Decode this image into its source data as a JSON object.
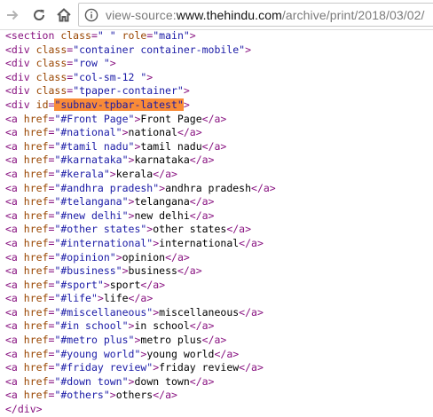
{
  "address_bar": {
    "scheme": "view-source:",
    "host": "www.thehindu.com",
    "path": "/archive/print/2018/03/02/"
  },
  "header_lines": [
    {
      "tag": "section",
      "attrs": [
        {
          "n": "class",
          "v": "\" \""
        },
        {
          "n": "role",
          "v": "\"main\""
        }
      ]
    },
    {
      "tag": "div",
      "attrs": [
        {
          "n": "class",
          "v": "\"container container-mobile\""
        }
      ]
    },
    {
      "tag": "div",
      "attrs": [
        {
          "n": "class",
          "v": "\"row \""
        }
      ]
    },
    {
      "tag": "div",
      "attrs": [
        {
          "n": "class",
          "v": "\"col-sm-12 \""
        }
      ]
    },
    {
      "tag": "div",
      "attrs": [
        {
          "n": "class",
          "v": "\"tpaper-container\""
        }
      ]
    }
  ],
  "subnav_div": {
    "attr": "id",
    "value": "\"subnav-tpbar-latest\""
  },
  "links": [
    {
      "href": "\"#Front Page\"",
      "text": "Front Page"
    },
    {
      "href": "\"#national\"",
      "text": "national"
    },
    {
      "href": "\"#tamil nadu\"",
      "text": "tamil nadu"
    },
    {
      "href": "\"#karnataka\"",
      "text": "karnataka"
    },
    {
      "href": "\"#kerala\"",
      "text": "kerala"
    },
    {
      "href": "\"#andhra pradesh\"",
      "text": "andhra pradesh"
    },
    {
      "href": "\"#telangana\"",
      "text": "telangana"
    },
    {
      "href": "\"#new delhi\"",
      "text": "new delhi"
    },
    {
      "href": "\"#other states\"",
      "text": "other states"
    },
    {
      "href": "\"#international\"",
      "text": "international"
    },
    {
      "href": "\"#opinion\"",
      "text": "opinion"
    },
    {
      "href": "\"#business\"",
      "text": "business"
    },
    {
      "href": "\"#sport\"",
      "text": "sport"
    },
    {
      "href": "\"#life\"",
      "text": "life"
    },
    {
      "href": "\"#miscellaneous\"",
      "text": "miscellaneous"
    },
    {
      "href": "\"#in school\"",
      "text": "in school"
    },
    {
      "href": "\"#metro plus\"",
      "text": "metro plus"
    },
    {
      "href": "\"#young world\"",
      "text": "young world"
    },
    {
      "href": "\"#friday review\"",
      "text": "friday review"
    },
    {
      "href": "\"#down town\"",
      "text": "down town"
    },
    {
      "href": "\"#others\"",
      "text": "others"
    }
  ],
  "closing_tag": "</div>",
  "icons": {
    "forward": "forward-arrow-icon",
    "reload": "reload-icon",
    "home": "home-icon",
    "info": "info-icon"
  },
  "colors": {
    "tag": "#881280",
    "attr_name": "#994500",
    "attr_value": "#1a1aa6",
    "highlight": "#f98b37"
  }
}
